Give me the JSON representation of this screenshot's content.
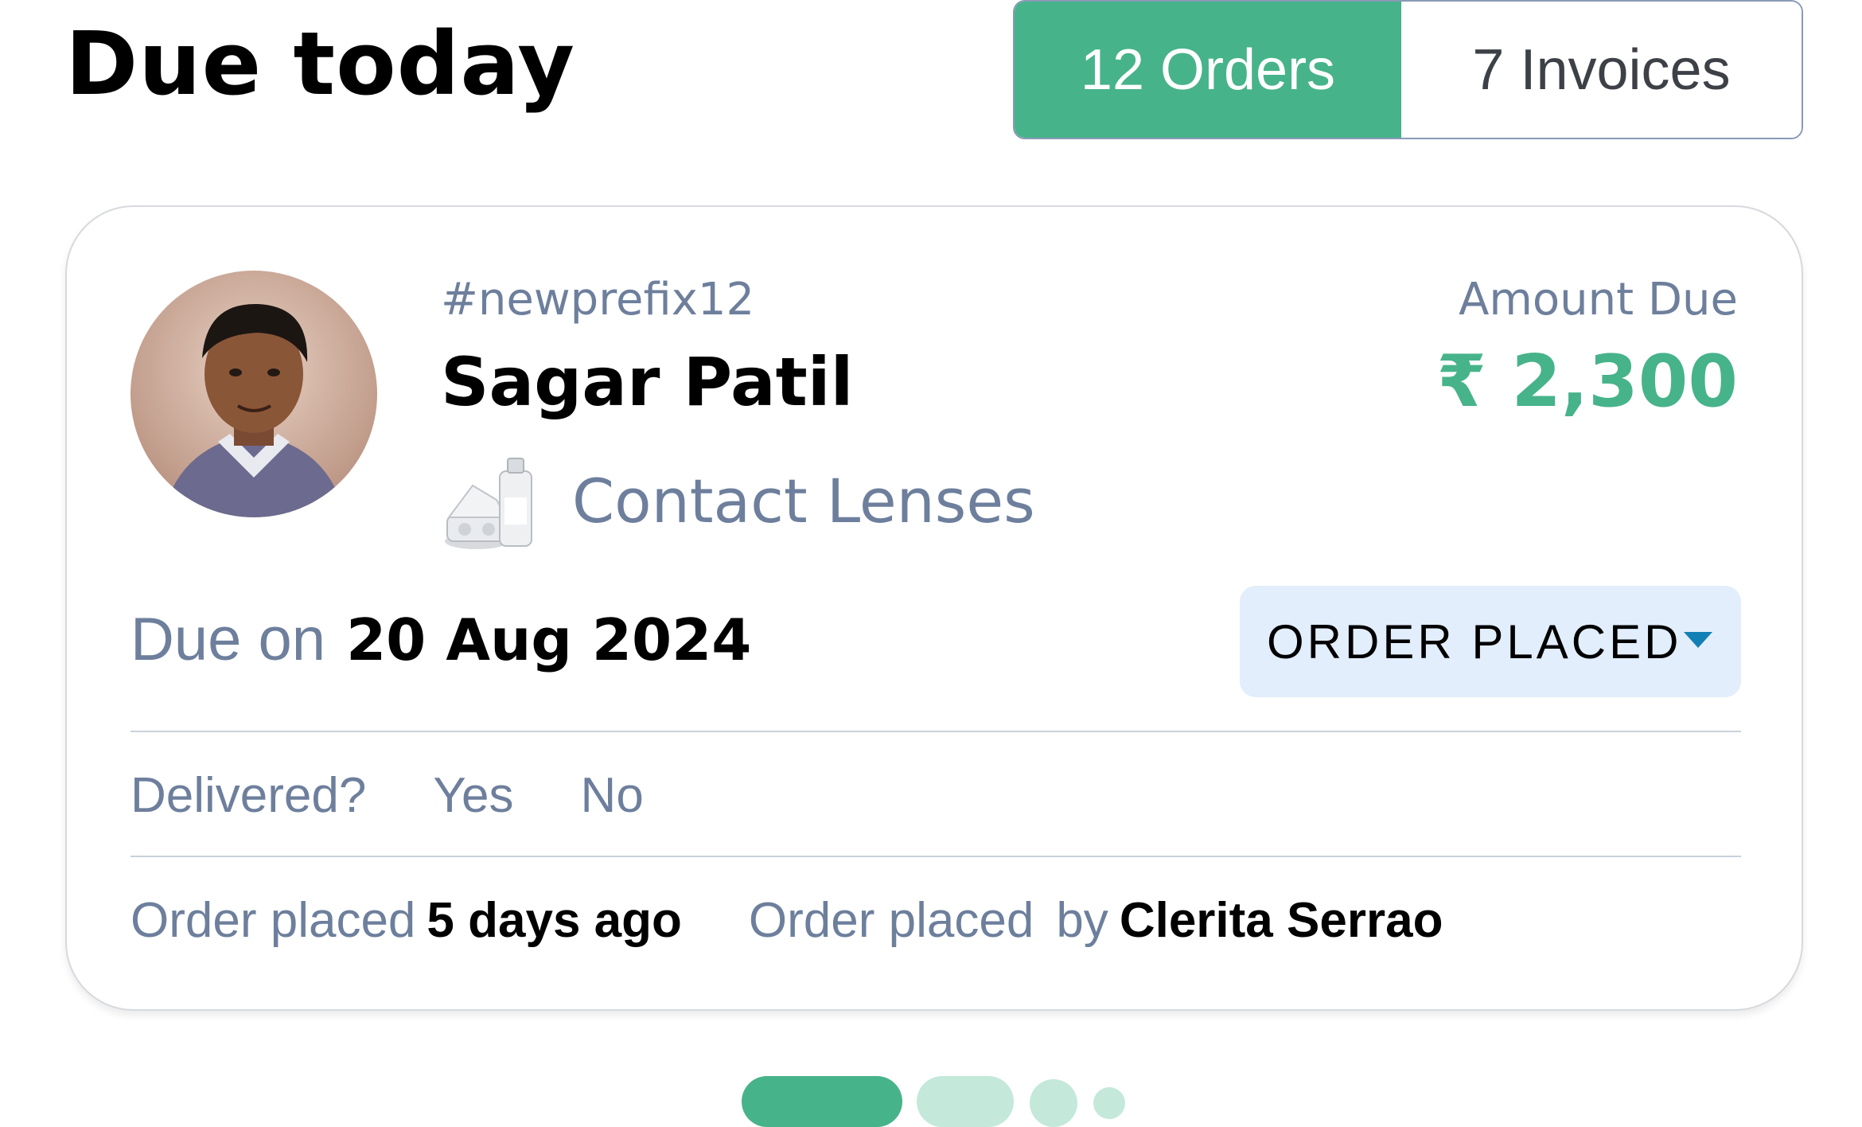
{
  "header": {
    "title": "Due today",
    "tabs": [
      {
        "label": "12 Orders",
        "active": true
      },
      {
        "label": "7 Invoices",
        "active": false
      }
    ]
  },
  "order_card": {
    "order_id": "#newprefix12",
    "customer_name": "Sagar Patil",
    "product": "Contact Lenses",
    "amount_label": "Amount Due",
    "amount_value": "₹ 2,300",
    "due_label": "Due on",
    "due_date": "20 Aug 2024",
    "status": "ORDER PLACED",
    "delivered": {
      "question": "Delivered?",
      "yes_label": "Yes",
      "no_label": "No"
    },
    "meta": {
      "placed_label": "Order placed",
      "placed_when": "5 days ago",
      "placed_by_label": "Order placed",
      "by_word": "by",
      "placed_by": "Clerita Serrao"
    }
  },
  "pager": {
    "total_pages": 4,
    "active_index": 0
  },
  "colors": {
    "accent": "#47b38a",
    "muted_text": "#6d7f9c",
    "status_bg": "#e2eefb",
    "caret": "#127fb5"
  }
}
